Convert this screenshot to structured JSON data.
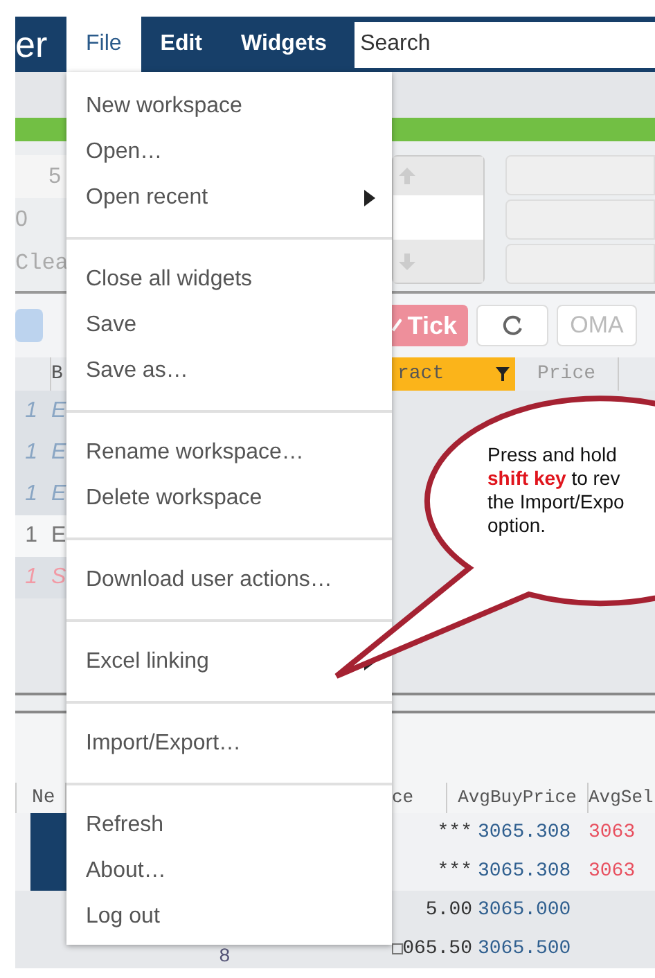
{
  "app_bar": {
    "brand": "er",
    "menus": [
      {
        "label": "File",
        "selected": true
      },
      {
        "label": "Edit",
        "selected": false
      },
      {
        "label": "Widgets",
        "selected": false
      }
    ],
    "search": {
      "placeholder": "Search"
    }
  },
  "order_panel": {
    "left_cells": [
      "5",
      "0",
      "Clea"
    ]
  },
  "toolbar": {
    "buttons": [
      {
        "kind": "tick",
        "label": "Tick"
      },
      {
        "kind": "refresh"
      },
      {
        "kind": "text",
        "label": "OMA"
      }
    ]
  },
  "orders_table": {
    "columns": [
      "",
      "B",
      "ract",
      "Price"
    ],
    "rows": [
      {
        "kind": "buy",
        "selected": false,
        "cells": [
          "1",
          "E"
        ]
      },
      {
        "kind": "buy",
        "selected": false,
        "cells": [
          "1",
          "E"
        ]
      },
      {
        "kind": "buy",
        "selected": false,
        "cells": [
          "1",
          "E"
        ]
      },
      {
        "kind": "plain",
        "selected": true,
        "cells": [
          "1",
          "E"
        ]
      },
      {
        "kind": "sell",
        "selected": false,
        "cells": [
          "1",
          "S"
        ]
      }
    ]
  },
  "positions_table": {
    "columns": [
      "Ne",
      "ce",
      "AvgBuyPrice",
      "AvgSel"
    ],
    "rows": [
      {
        "marker": true,
        "col_2": "***",
        "avg_buy": "3065.308",
        "avg_sell": "3063"
      },
      {
        "marker": true,
        "col_2": "***",
        "avg_buy": "3065.308",
        "avg_sell": "3063"
      },
      {
        "marker": false,
        "col_2": "5.00",
        "avg_buy": "3065.000"
      },
      {
        "marker": false,
        "col_1": "8",
        "col_2": "065.50",
        "avg_buy": "3065.500"
      }
    ]
  },
  "file_menu": {
    "groups": [
      [
        {
          "label": "New workspace",
          "submenu": false
        },
        {
          "label": "Open…",
          "submenu": false
        },
        {
          "label": "Open recent",
          "submenu": true
        }
      ],
      [
        {
          "label": "Close all widgets",
          "submenu": false
        },
        {
          "label": "Save",
          "submenu": false
        },
        {
          "label": "Save as…",
          "submenu": false
        }
      ],
      [
        {
          "label": "Rename workspace…",
          "submenu": false
        },
        {
          "label": "Delete workspace",
          "submenu": false
        }
      ],
      [
        {
          "label": "Download user actions…",
          "submenu": false
        }
      ],
      [
        {
          "label": "Excel linking",
          "submenu": true
        }
      ],
      [
        {
          "label": "Import/Export…",
          "submenu": false
        }
      ],
      [
        {
          "label": "Refresh",
          "submenu": false
        },
        {
          "label": "About…",
          "submenu": false
        },
        {
          "label": "Log out",
          "submenu": false
        }
      ]
    ]
  },
  "callout": {
    "lines": [
      "Press and hold",
      "**shift key** to rev",
      "the Import/Expo",
      "option."
    ]
  }
}
